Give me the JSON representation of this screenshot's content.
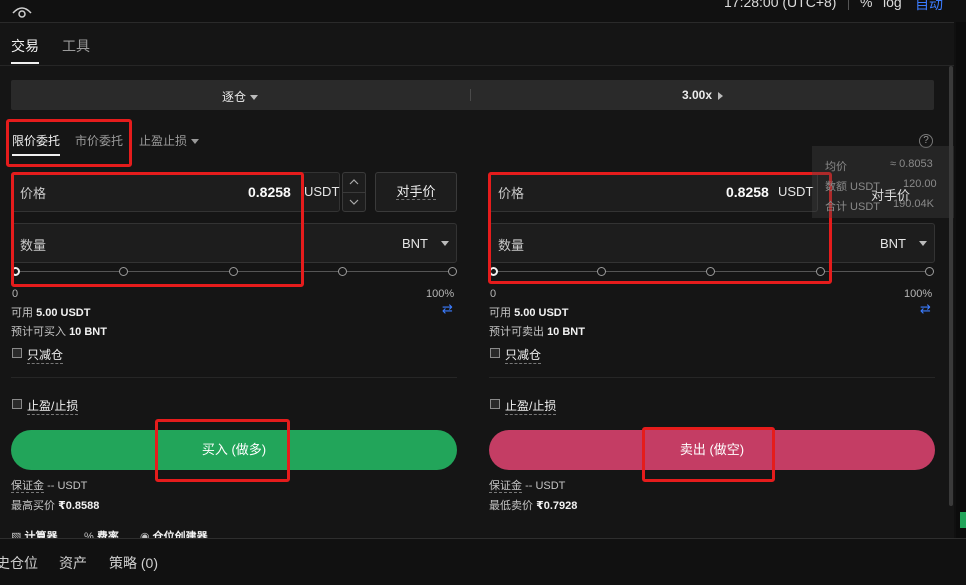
{
  "header": {
    "time": "17:28:00 (UTC+8)",
    "percent": "%",
    "log": "log",
    "auto": "自动"
  },
  "tabs": [
    "交易",
    "工具"
  ],
  "margin_mode": "逐仓",
  "leverage": "3.00x",
  "order_types": [
    "限价委托",
    "市价委托",
    "止盈止损"
  ],
  "buy": {
    "price_label": "价格",
    "price_value": "0.8258",
    "price_unit": "USDT",
    "counterparty_label": "对手价",
    "qty_label": "数量",
    "qty_unit": "BNT",
    "slider_min": "0",
    "slider_max": "100%",
    "available_label": "可用",
    "available_value": "5.00 USDT",
    "estimate_label": "预计可买入",
    "estimate_value": "10 BNT",
    "reduce_only": "只减仓",
    "tpsl": "止盈/止损",
    "button": "买入 (做多)",
    "margin_label": "保证金",
    "margin_value": "-- USDT",
    "max_label": "最高买价",
    "max_value": "₹0.8588"
  },
  "sell": {
    "price_label": "价格",
    "price_value": "0.8258",
    "price_unit": "USDT",
    "qty_label": "数量",
    "qty_unit": "BNT",
    "slider_min": "0",
    "slider_max": "100%",
    "available_label": "可用",
    "available_value": "5.00 USDT",
    "estimate_label": "预计可卖出",
    "estimate_value": "10 BNT",
    "reduce_only": "只减仓",
    "tpsl": "止盈/止损",
    "button": "卖出 (做空)",
    "margin_label": "保证金",
    "margin_value": "-- USDT",
    "min_label": "最低卖价",
    "min_value": "₹0.7928"
  },
  "overlay": {
    "avg_label": "均价",
    "avg_value": "≈ 0.8053",
    "amount_label": "数额 USDT",
    "amount_value": "120.00",
    "total_label": "合计 USDT",
    "total_value": "190.04K",
    "counterparty": "对手价"
  },
  "footer_tools": [
    "计算器",
    "费率",
    "仓位创建器"
  ],
  "bottom_tabs": [
    "史仓位",
    "资产",
    "策略 (0)"
  ],
  "colors": {
    "buy": "#22a55a",
    "sell": "#c43d64",
    "link": "#3b7cff",
    "annotation": "#e51c1c"
  },
  "progress": {
    "buy_slider": 0,
    "sell_slider": 0
  }
}
